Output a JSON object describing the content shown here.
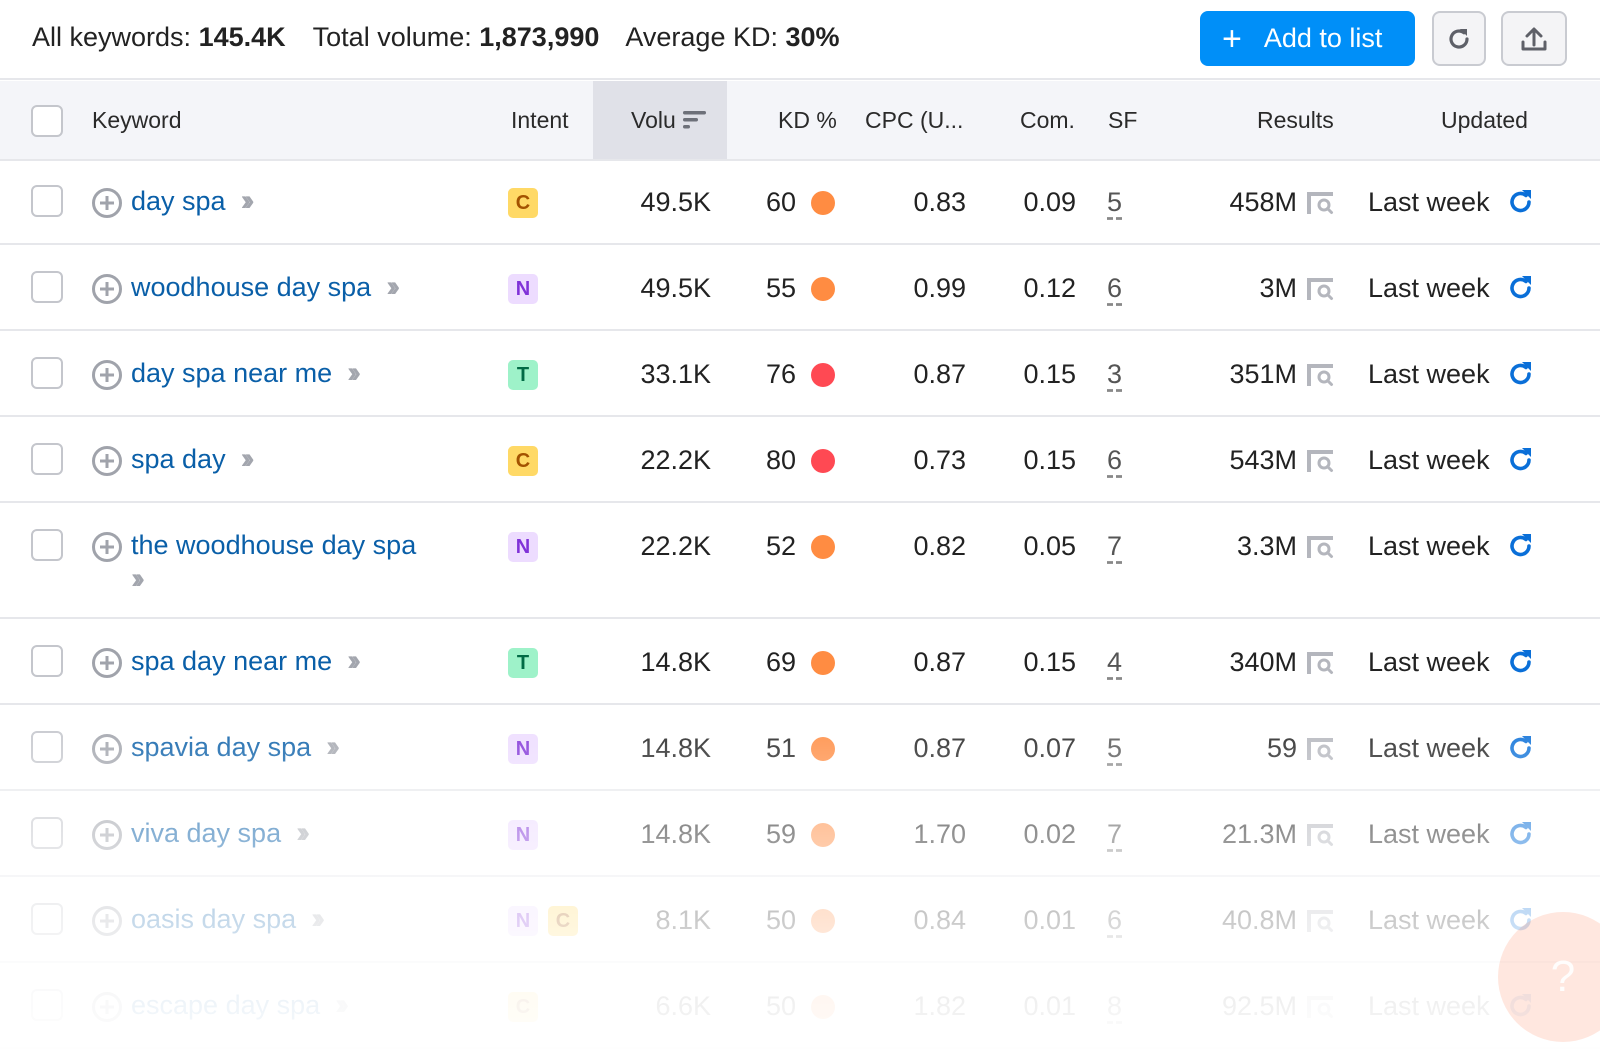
{
  "summary": {
    "all_keywords_label": "All keywords:",
    "all_keywords_value": "145.4K",
    "total_volume_label": "Total volume:",
    "total_volume_value": "1,873,990",
    "avg_kd_label": "Average KD:",
    "avg_kd_value": "30%"
  },
  "toolbar": {
    "add_to_list_label": "Add to list",
    "add_icon": "plus-icon",
    "refresh_icon": "refresh-icon",
    "export_icon": "export-icon"
  },
  "columns": {
    "keyword": "Keyword",
    "intent": "Intent",
    "volume": "Volu",
    "kd": "KD %",
    "cpc": "CPC (U...",
    "com": "Com.",
    "sf": "SF",
    "results": "Results",
    "updated": "Updated"
  },
  "colors": {
    "accent": "#008ff8",
    "keyword_link": "#0a5fa8",
    "kd_orange": "#ff8c42",
    "kd_red": "#ff4953",
    "update_icon": "#0a6fd8"
  },
  "rows": [
    {
      "keyword": "day spa",
      "intents": [
        "C"
      ],
      "volume": "49.5K",
      "kd": "60",
      "kd_level": "orange",
      "cpc": "0.83",
      "com": "0.09",
      "sf": "5",
      "results": "458M",
      "updated": "Last week"
    },
    {
      "keyword": "woodhouse day spa",
      "intents": [
        "N"
      ],
      "volume": "49.5K",
      "kd": "55",
      "kd_level": "orange",
      "cpc": "0.99",
      "com": "0.12",
      "sf": "6",
      "results": "3M",
      "updated": "Last week"
    },
    {
      "keyword": "day spa near me",
      "intents": [
        "T"
      ],
      "volume": "33.1K",
      "kd": "76",
      "kd_level": "red",
      "cpc": "0.87",
      "com": "0.15",
      "sf": "3",
      "results": "351M",
      "updated": "Last week"
    },
    {
      "keyword": "spa day",
      "intents": [
        "C"
      ],
      "volume": "22.2K",
      "kd": "80",
      "kd_level": "red",
      "cpc": "0.73",
      "com": "0.15",
      "sf": "6",
      "results": "543M",
      "updated": "Last week"
    },
    {
      "keyword": "the woodhouse day spa",
      "intents": [
        "N"
      ],
      "volume": "22.2K",
      "kd": "52",
      "kd_level": "orange",
      "cpc": "0.82",
      "com": "0.05",
      "sf": "7",
      "results": "3.3M",
      "updated": "Last week"
    },
    {
      "keyword": "spa day near me",
      "intents": [
        "T"
      ],
      "volume": "14.8K",
      "kd": "69",
      "kd_level": "orange",
      "cpc": "0.87",
      "com": "0.15",
      "sf": "4",
      "results": "340M",
      "updated": "Last week"
    },
    {
      "keyword": "spavia day spa",
      "intents": [
        "N"
      ],
      "volume": "14.8K",
      "kd": "51",
      "kd_level": "orange",
      "cpc": "0.87",
      "com": "0.07",
      "sf": "5",
      "results": "59",
      "updated": "Last week"
    },
    {
      "keyword": "viva day spa",
      "intents": [
        "N"
      ],
      "volume": "14.8K",
      "kd": "59",
      "kd_level": "orange",
      "cpc": "1.70",
      "com": "0.02",
      "sf": "7",
      "results": "21.3M",
      "updated": "Last week"
    },
    {
      "keyword": "oasis day spa",
      "intents": [
        "N",
        "C"
      ],
      "volume": "8.1K",
      "kd": "50",
      "kd_level": "orange",
      "cpc": "0.84",
      "com": "0.01",
      "sf": "6",
      "results": "40.8M",
      "updated": "Last week"
    },
    {
      "keyword": "escape day spa",
      "intents": [
        "C"
      ],
      "volume": "6.6K",
      "kd": "50",
      "kd_level": "orange",
      "cpc": "1.82",
      "com": "0.01",
      "sf": "8",
      "results": "92.5M",
      "updated": "Last week"
    }
  ],
  "help": {
    "label": "?"
  }
}
